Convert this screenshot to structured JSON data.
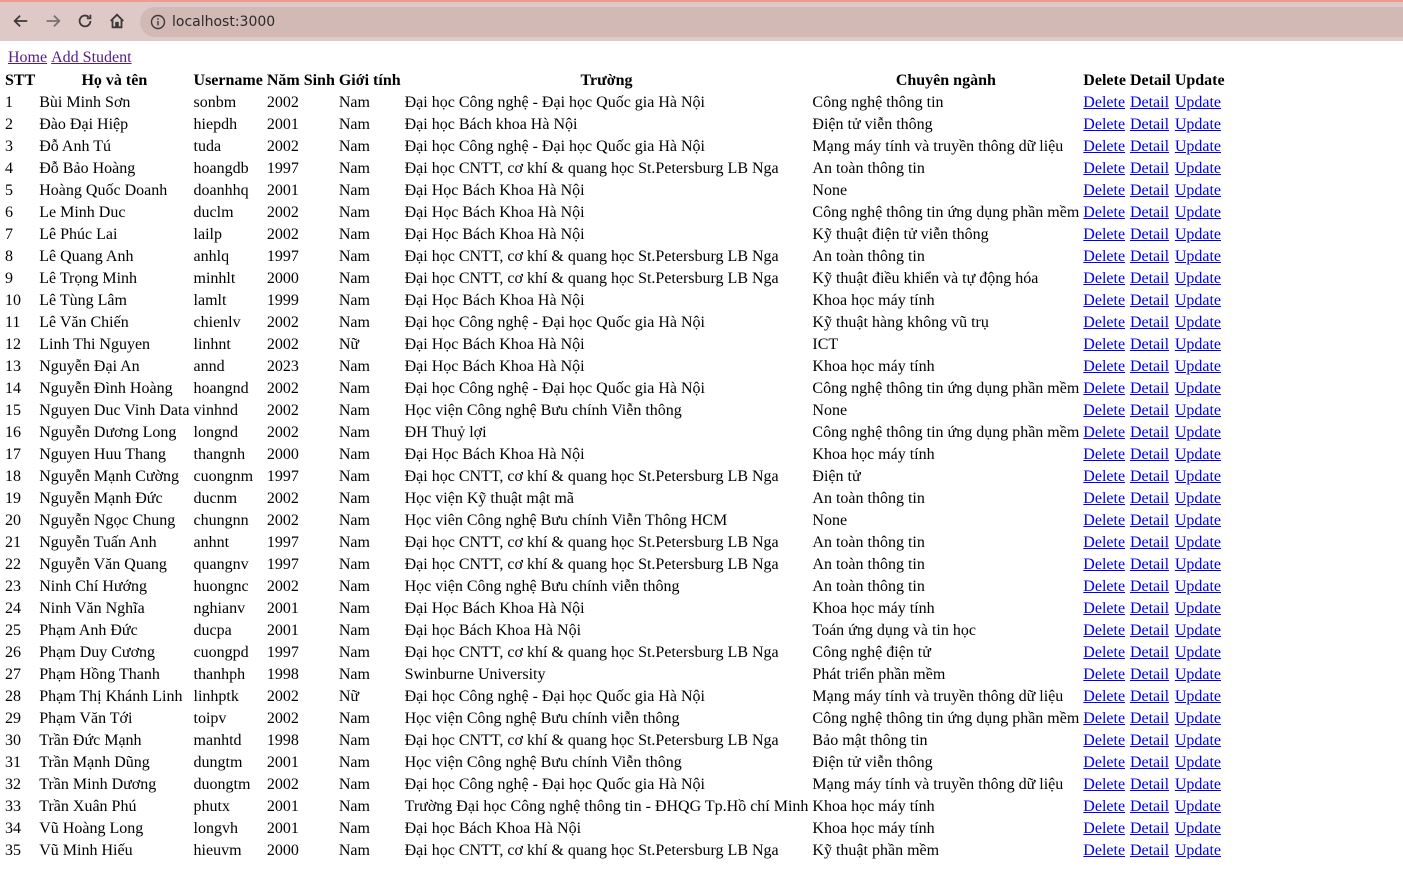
{
  "browser": {
    "url": "localhost:3000"
  },
  "nav": {
    "home": "Home",
    "add": "Add Student"
  },
  "headers": [
    "STT",
    "Họ và tên",
    "Username",
    "Năm Sinh",
    "Giới tính",
    "Trường",
    "Chuyên ngành",
    "Delete",
    "Detail",
    "Update"
  ],
  "actions": {
    "delete": "Delete",
    "detail": "Detail",
    "update": "Update"
  },
  "students": [
    [
      "1",
      "Bùi Minh Sơn",
      "sonbm",
      "2002",
      "Nam",
      "Đại học Công nghệ - Đại học Quốc gia Hà Nội",
      "Công nghệ thông tin"
    ],
    [
      "2",
      "Đào Đại Hiệp",
      "hiepdh",
      "2001",
      "Nam",
      "Đại học Bách khoa Hà Nội",
      "Điện tử viễn thông"
    ],
    [
      "3",
      "Đỗ Anh Tú",
      "tuda",
      "2002",
      "Nam",
      "Đại học Công nghệ - Đại học Quốc gia Hà Nội",
      "Mạng máy tính và truyền thông dữ liệu"
    ],
    [
      "4",
      "Đỗ Bảo Hoàng",
      "hoangdb",
      "1997",
      "Nam",
      "Đại học CNTT, cơ khí & quang học St.Petersburg LB Nga",
      "An toàn thông tin"
    ],
    [
      "5",
      "Hoàng Quốc Doanh",
      "doanhhq",
      "2001",
      "Nam",
      "Đại Học Bách Khoa Hà Nội",
      "None"
    ],
    [
      "6",
      "Le Minh Duc",
      "duclm",
      "2002",
      "Nam",
      "Đại Học Bách Khoa Hà Nội",
      "Công nghệ thông tin ứng dụng phần mềm"
    ],
    [
      "7",
      "Lê Phúc Lai",
      "lailp",
      "2002",
      "Nam",
      "Đại Học Bách Khoa Hà Nội",
      "Kỹ thuật điện tử viễn thông"
    ],
    [
      "8",
      "Lê Quang Anh",
      "anhlq",
      "1997",
      "Nam",
      "Đại học CNTT, cơ khí & quang học St.Petersburg LB Nga",
      "An toàn thông tin"
    ],
    [
      "9",
      "Lê Trọng Minh",
      "minhlt",
      "2000",
      "Nam",
      "Đại học CNTT, cơ khí & quang học St.Petersburg LB Nga",
      "Kỹ thuật điều khiển và tự động hóa"
    ],
    [
      "10",
      "Lê Tùng Lâm",
      "lamlt",
      "1999",
      "Nam",
      "Đại Học Bách Khoa Hà Nội",
      "Khoa học máy tính"
    ],
    [
      "11",
      "Lê Văn Chiến",
      "chienlv",
      "2002",
      "Nam",
      "Đại học Công nghệ - Đại học Quốc gia Hà Nội",
      "Kỹ thuật hàng không vũ trụ"
    ],
    [
      "12",
      "Linh Thi Nguyen",
      "linhnt",
      "2002",
      "Nữ",
      "Đại Học Bách Khoa Hà Nội",
      "ICT"
    ],
    [
      "13",
      "Nguyễn Đại An",
      "annd",
      "2023",
      "Nam",
      "Đại Học Bách Khoa Hà Nội",
      "Khoa học máy tính"
    ],
    [
      "14",
      "Nguyễn Đình Hoàng",
      "hoangnd",
      "2002",
      "Nam",
      "Đại học Công nghệ - Đại học Quốc gia Hà Nội",
      "Công nghệ thông tin ứng dụng phần mềm"
    ],
    [
      "15",
      "Nguyen Duc Vinh Data",
      "vinhnd",
      "2002",
      "Nam",
      "Học viện Công nghệ Bưu chính Viễn thông",
      "None"
    ],
    [
      "16",
      "Nguyễn Dương Long",
      "longnd",
      "2002",
      "Nam",
      "ĐH Thuỷ lợi",
      "Công nghệ thông tin ứng dụng phần mềm"
    ],
    [
      "17",
      "Nguyen Huu Thang",
      "thangnh",
      "2000",
      "Nam",
      "Đại Học Bách Khoa Hà Nội",
      "Khoa học máy tính"
    ],
    [
      "18",
      "Nguyễn Mạnh Cường",
      "cuongnm",
      "1997",
      "Nam",
      "Đại học CNTT, cơ khí & quang học St.Petersburg LB Nga",
      "Điện tử"
    ],
    [
      "19",
      "Nguyễn Mạnh Đức",
      "ducnm",
      "2002",
      "Nam",
      "Học viện Kỹ thuật mật mã",
      "An toàn thông tin"
    ],
    [
      "20",
      "Nguyễn Ngọc Chung",
      "chungnn",
      "2002",
      "Nam",
      "Học viên Công nghệ Bưu chính Viễn Thông HCM",
      "None"
    ],
    [
      "21",
      "Nguyễn Tuấn Anh",
      "anhnt",
      "1997",
      "Nam",
      "Đại học CNTT, cơ khí & quang học St.Petersburg LB Nga",
      "An toàn thông tin"
    ],
    [
      "22",
      "Nguyễn Văn Quang",
      "quangnv",
      "1997",
      "Nam",
      "Đại học CNTT, cơ khí & quang học St.Petersburg LB Nga",
      "An toàn thông tin"
    ],
    [
      "23",
      "Ninh Chí Hướng",
      "huongnc",
      "2002",
      "Nam",
      "Học viện Công nghệ Bưu chính viễn thông",
      "An toàn thông tin"
    ],
    [
      "24",
      "Ninh Văn Nghĩa",
      "nghianv",
      "2001",
      "Nam",
      "Đại Học Bách Khoa Hà Nội",
      "Khoa học máy tính"
    ],
    [
      "25",
      "Phạm Anh Đức",
      "ducpa",
      "2001",
      "Nam",
      "Đại học Bách Khoa Hà Nội",
      "Toán ứng dụng và tin học"
    ],
    [
      "26",
      "Phạm Duy Cương",
      "cuongpd",
      "1997",
      "Nam",
      "Đại học CNTT, cơ khí & quang học St.Petersburg LB Nga",
      "Công nghệ điện tử"
    ],
    [
      "27",
      "Phạm Hồng Thanh",
      "thanhph",
      "1998",
      "Nam",
      "Swinburne University",
      "Phát triển phần mềm"
    ],
    [
      "28",
      "Phạm Thị Khánh Linh",
      "linhptk",
      "2002",
      "Nữ",
      "Đại học Công nghệ - Đại học Quốc gia Hà Nội",
      "Mạng máy tính và truyền thông dữ liệu"
    ],
    [
      "29",
      "Phạm Văn Tới",
      "toipv",
      "2002",
      "Nam",
      "Học viện Công nghệ Bưu chính viễn thông",
      "Công nghệ thông tin ứng dụng phần mềm"
    ],
    [
      "30",
      "Trần Đức Mạnh",
      "manhtd",
      "1998",
      "Nam",
      "Đại học CNTT, cơ khí & quang học St.Petersburg LB Nga",
      "Bảo mật thông tin"
    ],
    [
      "31",
      "Trần Mạnh Dũng",
      "dungtm",
      "2001",
      "Nam",
      "Học viện Công nghệ Bưu chính Viễn thông",
      "Điện tử viễn thông"
    ],
    [
      "32",
      "Trần Minh Dương",
      "duongtm",
      "2002",
      "Nam",
      "Đại học Công nghệ - Đại học Quốc gia Hà Nội",
      "Mạng máy tính và truyền thông dữ liệu"
    ],
    [
      "33",
      "Trần Xuân Phú",
      "phutx",
      "2001",
      "Nam",
      "Trường Đại học Công nghệ thông tin - ĐHQG Tp.Hồ chí Minh",
      "Khoa học máy tính"
    ],
    [
      "34",
      "Vũ Hoàng Long",
      "longvh",
      "2001",
      "Nam",
      "Đại học Bách Khoa Hà Nội",
      "Khoa học máy tính"
    ],
    [
      "35",
      "Vũ Minh Hiếu",
      "hieuvm",
      "2000",
      "Nam",
      "Đại học CNTT, cơ khí & quang học St.Petersburg LB Nga",
      "Kỹ thuật phần mềm"
    ]
  ]
}
